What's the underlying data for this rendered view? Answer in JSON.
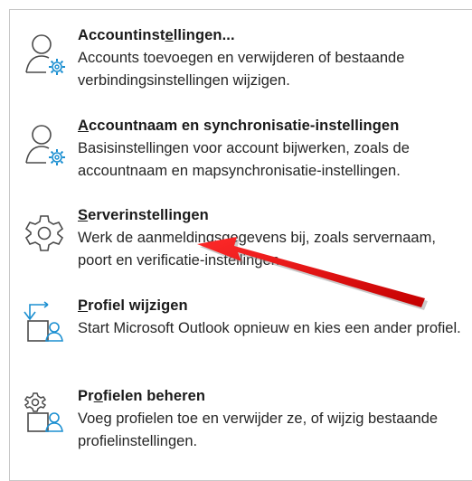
{
  "items": [
    {
      "title_pre": "Accountinst",
      "title_ul": "e",
      "title_post": "llingen...",
      "desc": "Accounts toevoegen en verwijderen of bestaande verbindingsinstellingen wijzigen.",
      "icon": "account-settings-icon"
    },
    {
      "title_pre": "",
      "title_ul": "A",
      "title_post": "ccountnaam en synchronisatie-instellingen",
      "desc": "Basisinstellingen voor account bijwerken, zoals de accountnaam en mapsynchronisatie-instellingen.",
      "icon": "account-sync-icon"
    },
    {
      "title_pre": "",
      "title_ul": "S",
      "title_post": "erverinstellingen",
      "desc": "Werk de aanmeldingsgegevens bij, zoals servernaam, poort en verificatie-instellingen.",
      "icon": "gear-icon"
    },
    {
      "title_pre": "",
      "title_ul": "P",
      "title_post": "rofiel wijzigen",
      "desc": "Start  Microsoft Outlook opnieuw en kies een ander profiel.",
      "icon": "switch-profile-icon"
    },
    {
      "title_pre": "Pr",
      "title_ul": "o",
      "title_post": "fielen beheren",
      "desc": "Voeg profielen toe en verwijder ze, of wijzig bestaande profielinstellingen.",
      "icon": "manage-profiles-icon"
    }
  ],
  "colors": {
    "accent": "#1b8fd1",
    "icon_gray": "#4a4a4a",
    "arrow": "#e81010"
  }
}
